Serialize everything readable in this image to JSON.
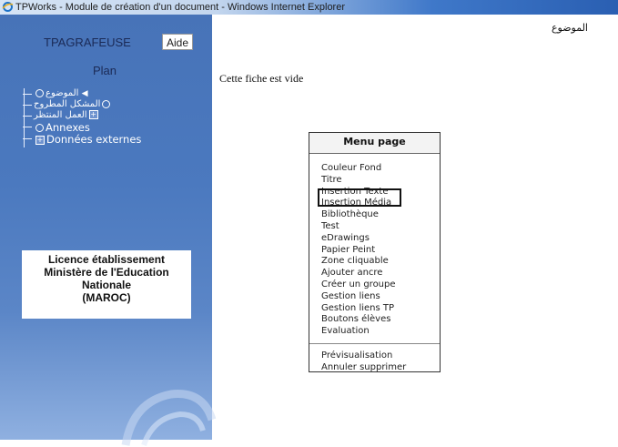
{
  "window": {
    "title": "TPWorks - Module de création d'un document - Windows Internet Explorer"
  },
  "sidebar": {
    "app_name": "TPAGRAFEUSE",
    "help_button": "Aide",
    "plan_label": "Plan",
    "tree": [
      {
        "label": "الموضوع",
        "icon": "arrow-icon"
      },
      {
        "label": "المشكل المطروح",
        "icon": "circle-icon"
      },
      {
        "label": "العمل المنتظر",
        "icon": "plus-box-icon"
      },
      {
        "label": "Annexes",
        "icon": "circle-icon"
      },
      {
        "label": "Données externes",
        "icon": "plus-box-icon"
      }
    ],
    "licence": {
      "line1": "Licence établissement",
      "line2": "Ministère de l'Education",
      "line3": "Nationale",
      "line4": "(MAROC)"
    }
  },
  "main": {
    "subject_label": "الموضوع",
    "empty_message": "Cette fiche est vide"
  },
  "menu": {
    "title": "Menu page",
    "items": [
      "Couleur Fond",
      "Titre",
      "Insertion Texte",
      "Insertion Média",
      "Bibliothèque",
      "Test",
      "eDrawings",
      "Papier Peint",
      "Zone cliquable",
      "Ajouter ancre",
      "Créer un groupe",
      "Gestion liens",
      "Gestion liens TP",
      "Boutons élèves",
      "Evaluation"
    ],
    "footer_items": [
      "Prévisualisation",
      "Annuler supprimer"
    ],
    "highlighted_item": "Insertion Média"
  },
  "colors": {
    "sidebar_blue": "#4b79bf",
    "titlebar_blue": "#2a5fb2"
  }
}
